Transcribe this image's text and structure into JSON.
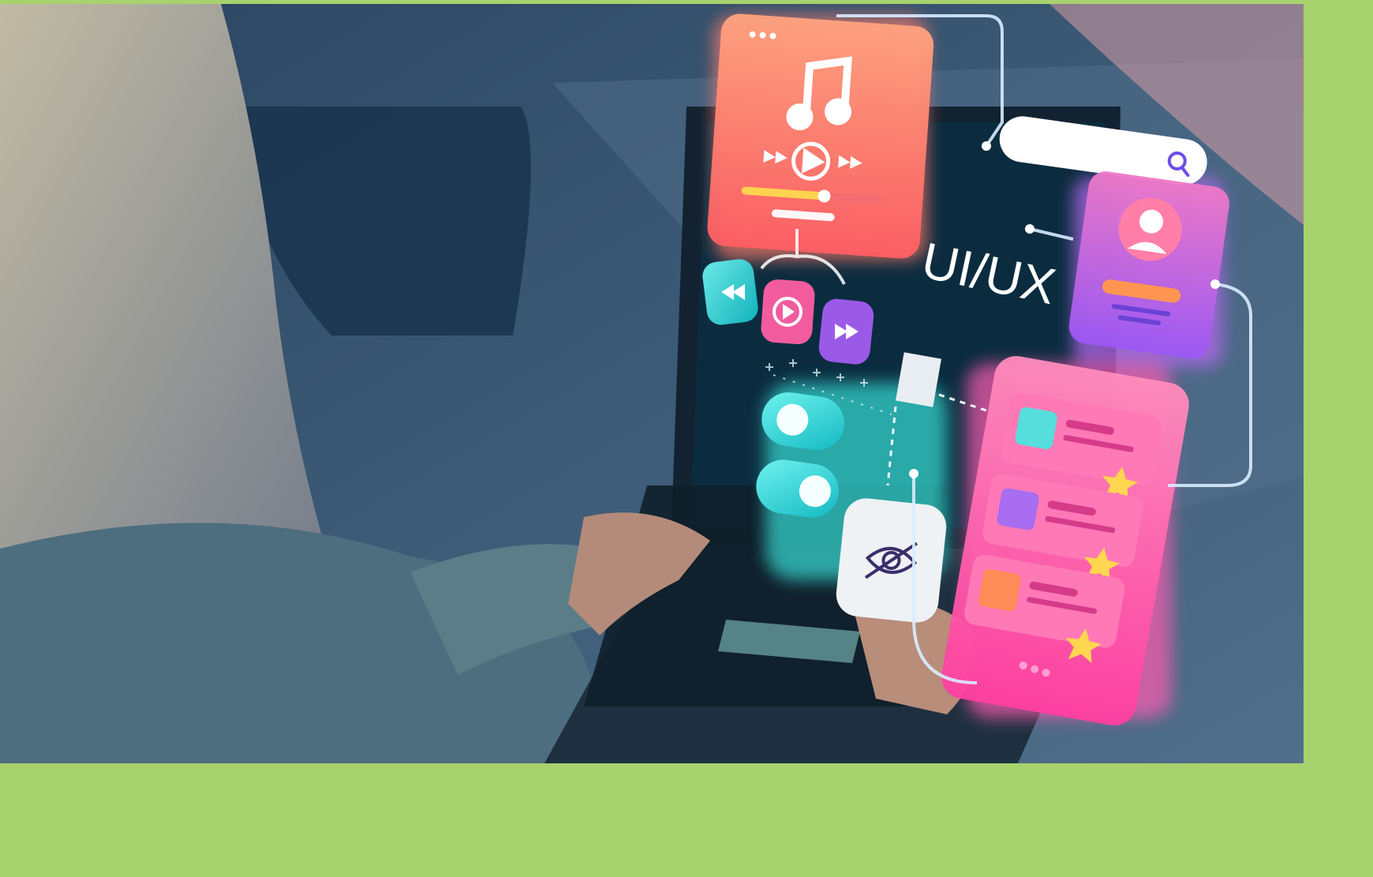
{
  "scene": {
    "background_color": "#a7d26d",
    "photo_subject": "person-using-laptop-with-holographic-ui",
    "overlay_text": "UI/UX",
    "icons": [
      "music-note-icon",
      "play-icon",
      "rewind-icon",
      "fast-forward-icon",
      "search-icon",
      "user-icon",
      "eye-off-icon",
      "star-icon"
    ],
    "colors": {
      "coral_card": "#ff7a6b",
      "purple_card": "#b563f2",
      "pink_card": "#ff5bb0",
      "teal_accent": "#39e0d6",
      "screen": "#0b2c3f"
    }
  }
}
